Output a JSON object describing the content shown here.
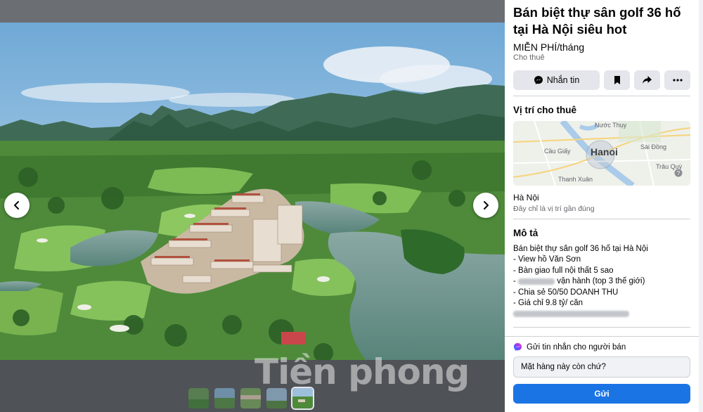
{
  "listing": {
    "title": "Bán biệt thự sân golf 36 hố tại Hà Nội siêu hot",
    "price": "MIỄN PHÍ/tháng",
    "category": "Cho thuê"
  },
  "actions": {
    "message_label": "Nhắn tin",
    "save_icon": "bookmark-icon",
    "share_icon": "share-icon",
    "more_icon": "more-icon"
  },
  "location": {
    "section_title": "Vị trí cho thuê",
    "city": "Hà Nội",
    "approx_note": "Đây chỉ là vị trí gần đúng",
    "map_labels": {
      "center": "Hanoi",
      "nuoc_thuy": "Nước Thụy",
      "cau_giay": "Cầu Giấy",
      "sai_dong": "Sài Đồng",
      "thanh_xuan": "Thanh Xuân",
      "trau_quy": "Trâu Quỳ"
    }
  },
  "description": {
    "section_title": "Mô tả",
    "lines": {
      "l1": "Bán biệt thự sân golf 36 hố tại Hà Nội",
      "l2": "- View hồ Văn Sơn",
      "l3": "- Bàn giao full nội thất 5 sao",
      "l4": "vận hành (top 3 thế giới)",
      "l5": "- Chia sẻ 50/50 DOANH THU",
      "l6": "- Giá chỉ 9.8 tỷ/ căn"
    }
  },
  "seller_message": {
    "heading": "Gửi tin nhắn cho người bán",
    "input_value": "Mặt hàng này còn chứ?",
    "send_label": "Gửi"
  },
  "watermark": "Tiền phong",
  "colors": {
    "accent": "#1b74e4",
    "panel_bg": "#ffffff",
    "viewer_bg": "#5a5d61"
  }
}
